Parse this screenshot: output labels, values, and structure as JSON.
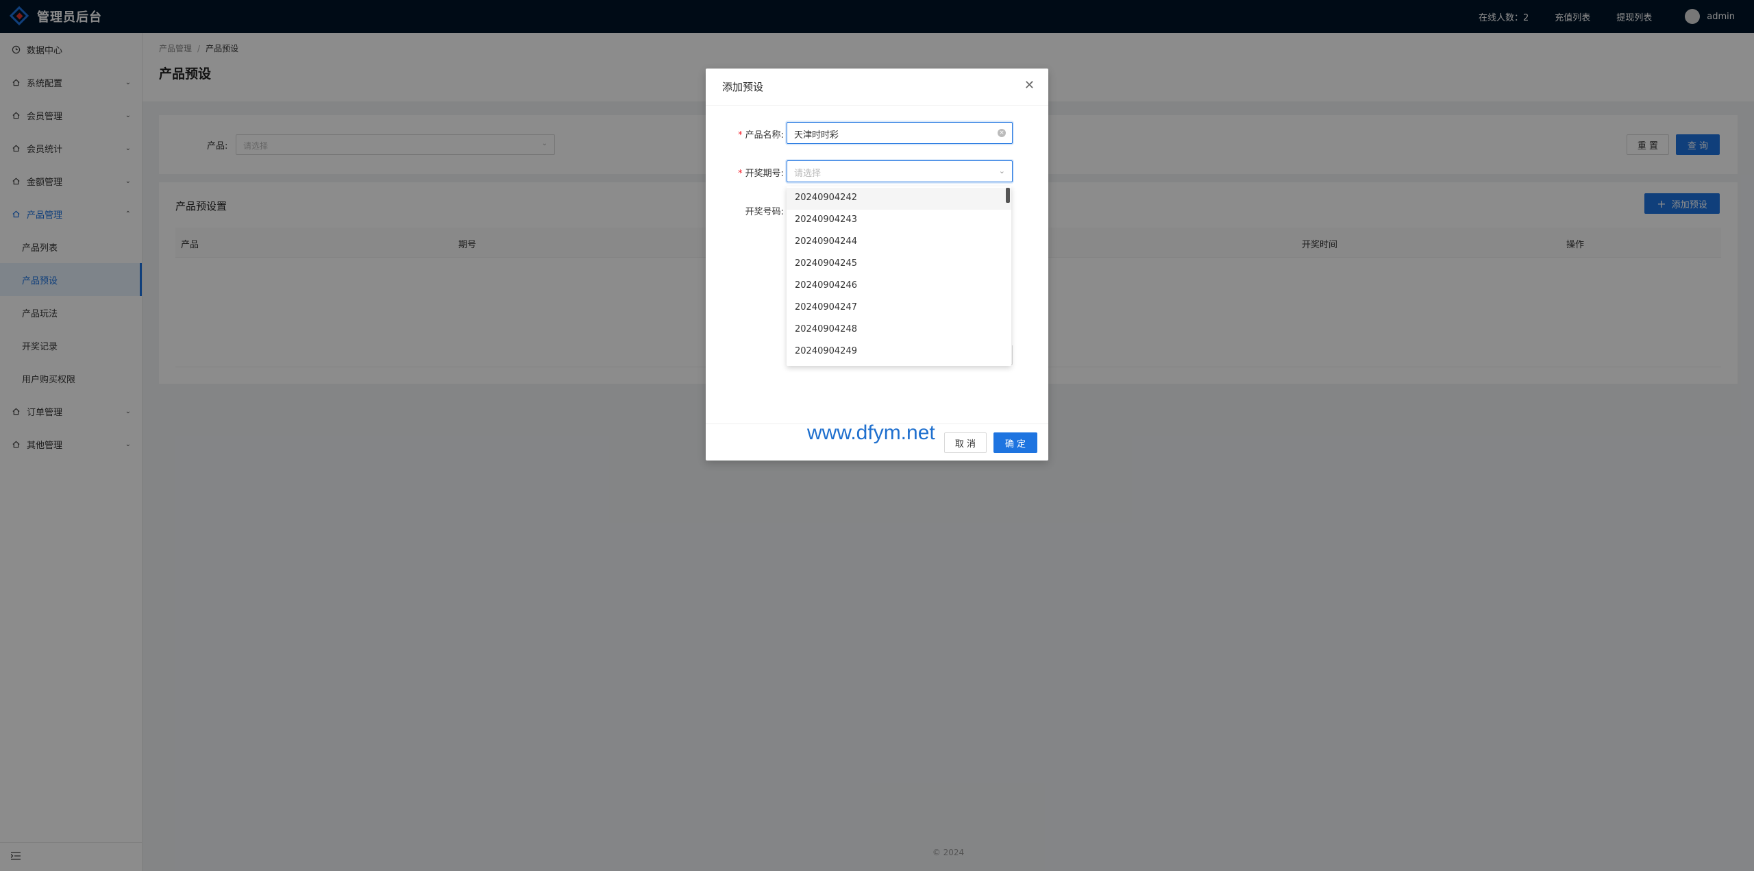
{
  "app": {
    "title": "管理员后台"
  },
  "header": {
    "online_label": "在线人数：2",
    "recharge_link": "充值列表",
    "withdraw_link": "提现列表",
    "username": "admin"
  },
  "sidebar": {
    "items": [
      {
        "label": "数据中心",
        "icon": "clock-icon"
      },
      {
        "label": "系统配置",
        "icon": "home-icon"
      },
      {
        "label": "会员管理",
        "icon": "home-icon"
      },
      {
        "label": "会员统计",
        "icon": "home-icon"
      },
      {
        "label": "金额管理",
        "icon": "home-icon"
      },
      {
        "label": "产品管理",
        "icon": "home-icon"
      },
      {
        "label": "订单管理",
        "icon": "home-icon"
      },
      {
        "label": "其他管理",
        "icon": "home-icon"
      }
    ],
    "product_sub": [
      "产品列表",
      "产品预设",
      "产品玩法",
      "开奖记录",
      "用户购买权限"
    ]
  },
  "breadcrumb": {
    "parent": "产品管理",
    "current": "产品预设"
  },
  "page": {
    "title": "产品预设"
  },
  "filter": {
    "product_label": "产品:",
    "product_placeholder": "请选择",
    "reset_label": "重 置",
    "query_label": "查 询"
  },
  "table": {
    "title": "产品预设置",
    "add_label": "添加预设",
    "columns": [
      "产品",
      "期号",
      "开奖时间",
      "操作"
    ]
  },
  "footer": {
    "copyright": "2024"
  },
  "modal": {
    "title": "添加预设",
    "product_name_label": "产品名称:",
    "product_name_value": "天津时时彩",
    "draw_period_label": "开奖期号:",
    "draw_period_placeholder": "请选择",
    "draw_number_label": "开奖号码:",
    "cancel_label": "取 消",
    "ok_label": "确 定",
    "watermark": "www.dfym.net"
  },
  "dropdown": {
    "options": [
      "20240904242",
      "20240904243",
      "20240904244",
      "20240904245",
      "20240904246",
      "20240904247",
      "20240904248",
      "20240904249"
    ]
  },
  "colors": {
    "primary": "#1e74e0",
    "header_bg": "#001529",
    "required": "#f5222d"
  }
}
